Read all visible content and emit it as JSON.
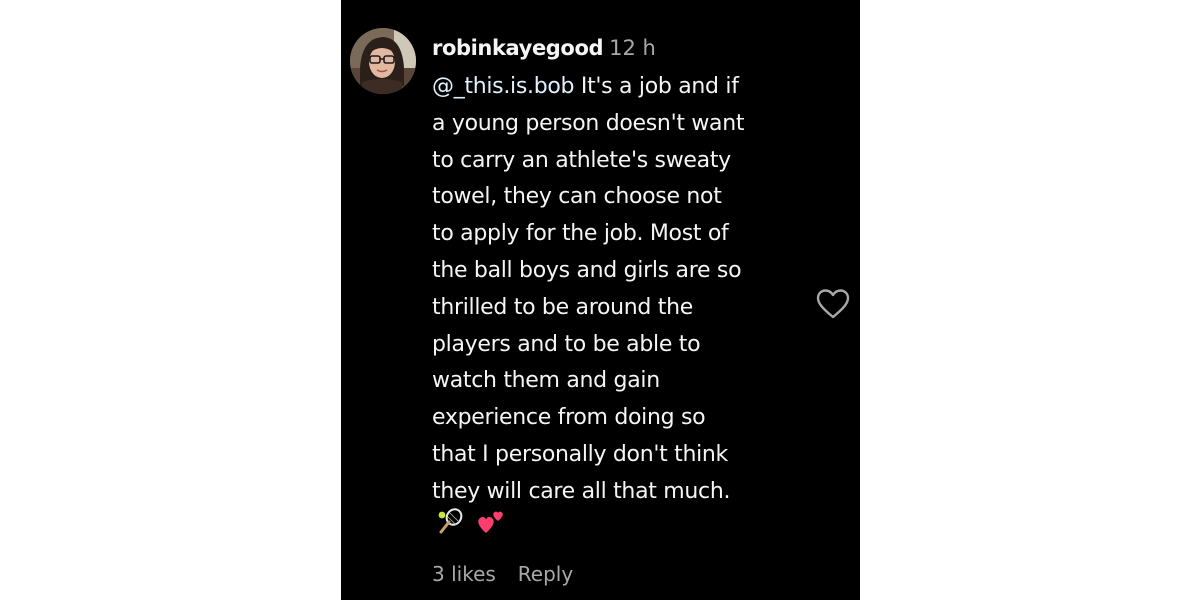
{
  "comment": {
    "username": "robinkayegood",
    "time": "12 h",
    "mention": "@_this.is.bob",
    "lines": [
      " It's a job and if",
      "a young person doesn't want",
      "to carry an athlete's sweaty",
      "towel, they can choose not",
      "to apply for the job. Most of",
      "the ball boys and girls are so",
      "thrilled to be around the",
      "players and to be able to",
      "watch them and gain",
      "experience from doing so",
      "that I personally don't think",
      "they will care all that much."
    ],
    "emojis": [
      "tennis-icon",
      "two-hearts-icon"
    ],
    "likes": "3 likes",
    "reply_label": "Reply"
  },
  "like_icon": "heart-outline-icon",
  "colors": {
    "background": "#000000",
    "text": "#f5f5f5",
    "secondary": "#a8a8a8",
    "mention": "#e0f1ff",
    "hearts": "#ff3d6e"
  }
}
